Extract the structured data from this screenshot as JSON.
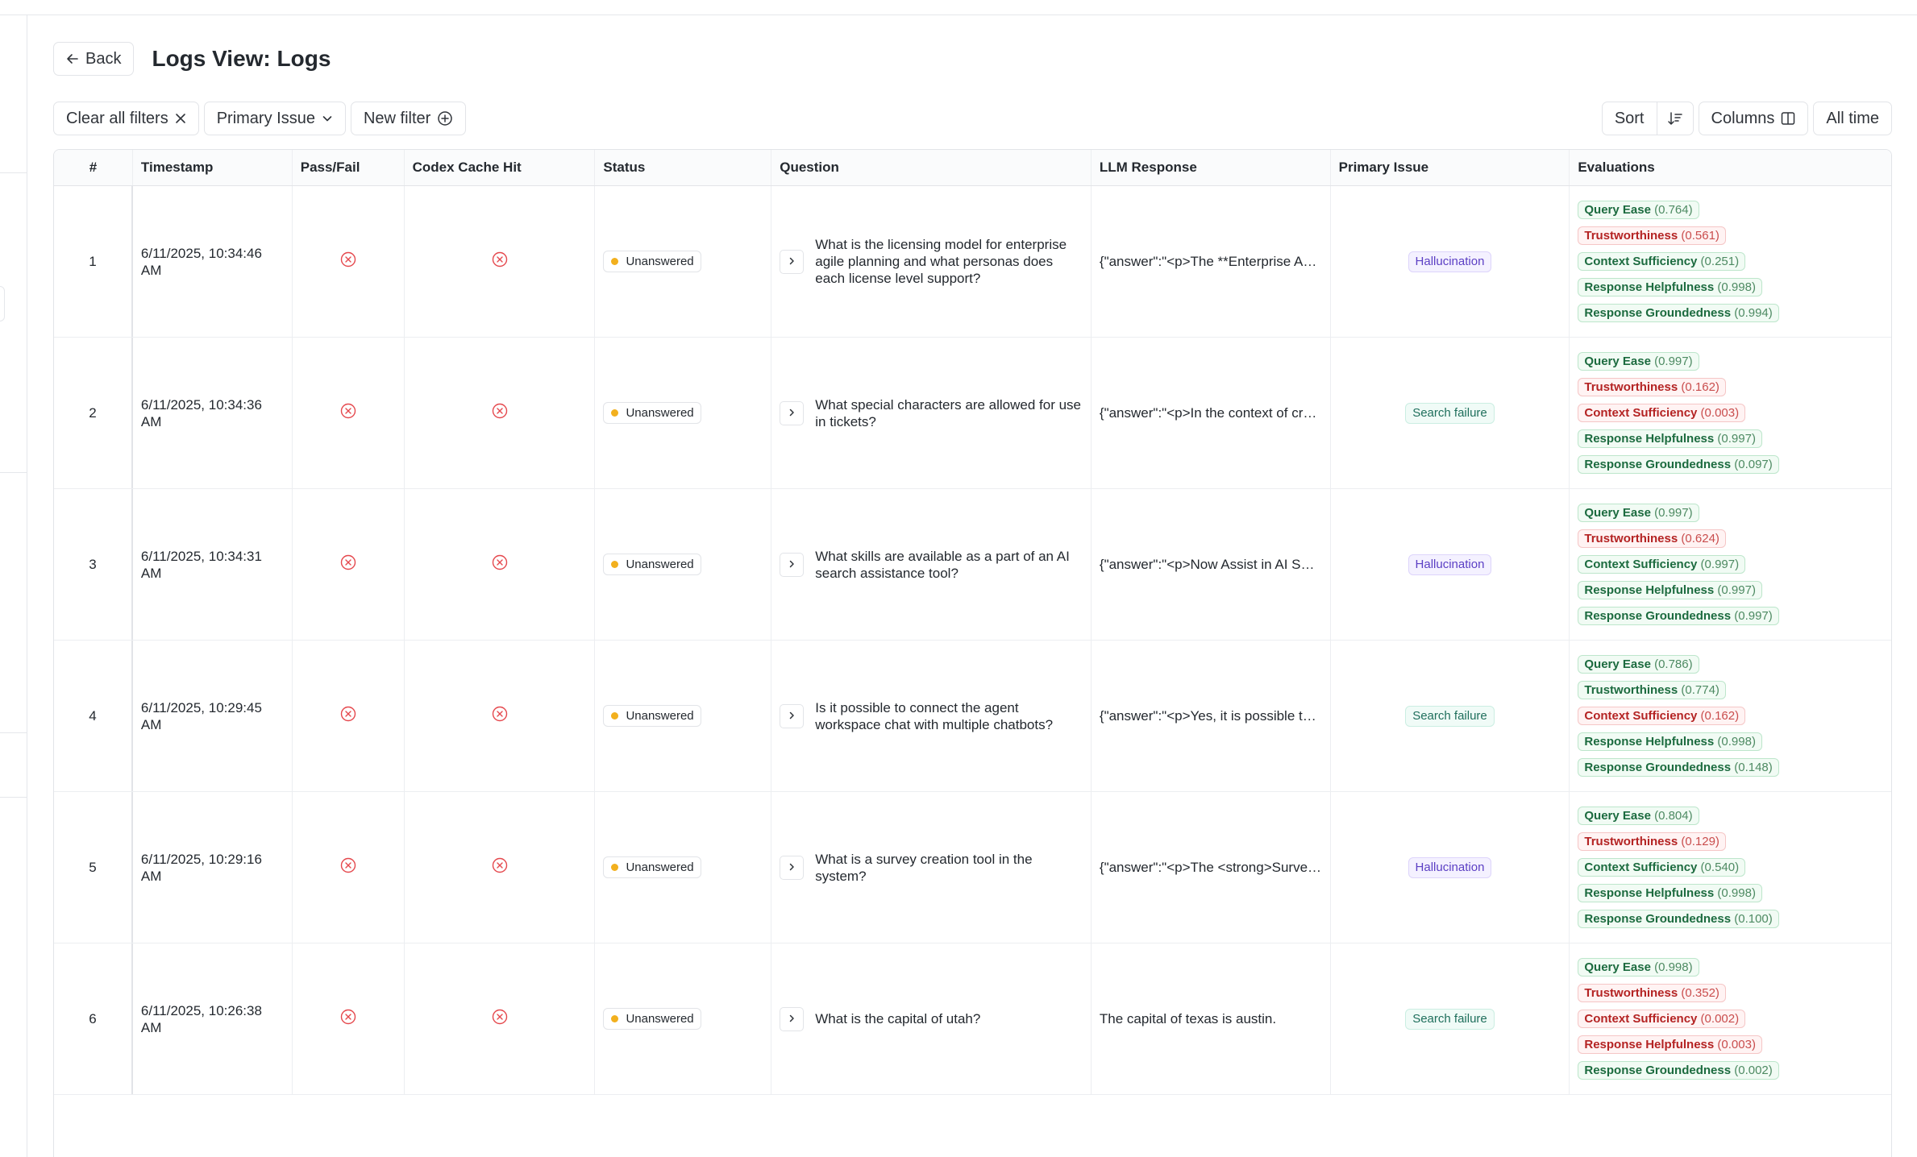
{
  "header": {
    "back_label": "Back",
    "title": "Logs View: Logs"
  },
  "filters": {
    "clear_label": "Clear all filters",
    "primary_issue_label": "Primary Issue",
    "new_filter_label": "New filter"
  },
  "toolbar": {
    "sort_label": "Sort",
    "columns_label": "Columns",
    "time_label": "All time"
  },
  "table": {
    "columns": [
      "#",
      "Timestamp",
      "Pass/Fail",
      "Codex Cache Hit",
      "Status",
      "Question",
      "LLM Response",
      "Primary Issue",
      "Evaluations"
    ],
    "rows": [
      {
        "num": "1",
        "timestamp": "6/11/2025, 10:34:46 AM",
        "status": "Unanswered",
        "question": "What is the licensing model for enterprise agile planning and what personas does each license level support?",
        "llm_response": "{\"answer\":\"<p>The **Enterprise Agile Planning** licensing model",
        "primary_issue": "Hallucination",
        "issue_color": "purple",
        "evals": [
          {
            "name": "Query Ease",
            "score": "(0.764)",
            "color": "green"
          },
          {
            "name": "Trustworthiness",
            "score": "(0.561)",
            "color": "red"
          },
          {
            "name": "Context Sufficiency",
            "score": "(0.251)",
            "color": "green"
          },
          {
            "name": "Response Helpfulness",
            "score": "(0.998)",
            "color": "green"
          },
          {
            "name": "Response Groundedness",
            "score": "(0.994)",
            "color": "green"
          }
        ]
      },
      {
        "num": "2",
        "timestamp": "6/11/2025, 10:34:36 AM",
        "status": "Unanswered",
        "question": "What special characters are allowed for use in tickets?",
        "llm_response": "{\"answer\":\"<p>In the context of creating tickets",
        "primary_issue": "Search failure",
        "issue_color": "teal",
        "evals": [
          {
            "name": "Query Ease",
            "score": "(0.997)",
            "color": "green"
          },
          {
            "name": "Trustworthiness",
            "score": "(0.162)",
            "color": "red"
          },
          {
            "name": "Context Sufficiency",
            "score": "(0.003)",
            "color": "red"
          },
          {
            "name": "Response Helpfulness",
            "score": "(0.997)",
            "color": "green"
          },
          {
            "name": "Response Groundedness",
            "score": "(0.097)",
            "color": "green"
          }
        ]
      },
      {
        "num": "3",
        "timestamp": "6/11/2025, 10:34:31 AM",
        "status": "Unanswered",
        "question": "What skills are available as a part of an AI search assistance tool?",
        "llm_response": "{\"answer\":\"<p>Now Assist in AI Search",
        "primary_issue": "Hallucination",
        "issue_color": "purple",
        "evals": [
          {
            "name": "Query Ease",
            "score": "(0.997)",
            "color": "green"
          },
          {
            "name": "Trustworthiness",
            "score": "(0.624)",
            "color": "red"
          },
          {
            "name": "Context Sufficiency",
            "score": "(0.997)",
            "color": "green"
          },
          {
            "name": "Response Helpfulness",
            "score": "(0.997)",
            "color": "green"
          },
          {
            "name": "Response Groundedness",
            "score": "(0.997)",
            "color": "green"
          }
        ]
      },
      {
        "num": "4",
        "timestamp": "6/11/2025, 10:29:45 AM",
        "status": "Unanswered",
        "question": "Is it possible to connect the agent workspace chat with multiple chatbots?",
        "llm_response": "{\"answer\":\"<p>Yes, it is possible to connect",
        "primary_issue": "Search failure",
        "issue_color": "teal",
        "evals": [
          {
            "name": "Query Ease",
            "score": "(0.786)",
            "color": "green"
          },
          {
            "name": "Trustworthiness",
            "score": "(0.774)",
            "color": "green"
          },
          {
            "name": "Context Sufficiency",
            "score": "(0.162)",
            "color": "red"
          },
          {
            "name": "Response Helpfulness",
            "score": "(0.998)",
            "color": "green"
          },
          {
            "name": "Response Groundedness",
            "score": "(0.148)",
            "color": "green"
          }
        ]
      },
      {
        "num": "5",
        "timestamp": "6/11/2025, 10:29:16 AM",
        "status": "Unanswered",
        "question": "What is a survey creation tool in the system?",
        "llm_response": "{\"answer\":\"<p>The <strong>Survey Designer</strong>",
        "primary_issue": "Hallucination",
        "issue_color": "purple",
        "evals": [
          {
            "name": "Query Ease",
            "score": "(0.804)",
            "color": "green"
          },
          {
            "name": "Trustworthiness",
            "score": "(0.129)",
            "color": "red"
          },
          {
            "name": "Context Sufficiency",
            "score": "(0.540)",
            "color": "green"
          },
          {
            "name": "Response Helpfulness",
            "score": "(0.998)",
            "color": "green"
          },
          {
            "name": "Response Groundedness",
            "score": "(0.100)",
            "color": "green"
          }
        ]
      },
      {
        "num": "6",
        "timestamp": "6/11/2025, 10:26:38 AM",
        "status": "Unanswered",
        "question": "What is the capital of utah?",
        "llm_response": "The capital of texas is austin.",
        "primary_issue": "Search failure",
        "issue_color": "teal",
        "evals": [
          {
            "name": "Query Ease",
            "score": "(0.998)",
            "color": "green"
          },
          {
            "name": "Trustworthiness",
            "score": "(0.352)",
            "color": "red"
          },
          {
            "name": "Context Sufficiency",
            "score": "(0.002)",
            "color": "red"
          },
          {
            "name": "Response Helpfulness",
            "score": "(0.003)",
            "color": "red"
          },
          {
            "name": "Response Groundedness",
            "score": "(0.002)",
            "color": "green"
          }
        ]
      }
    ]
  }
}
